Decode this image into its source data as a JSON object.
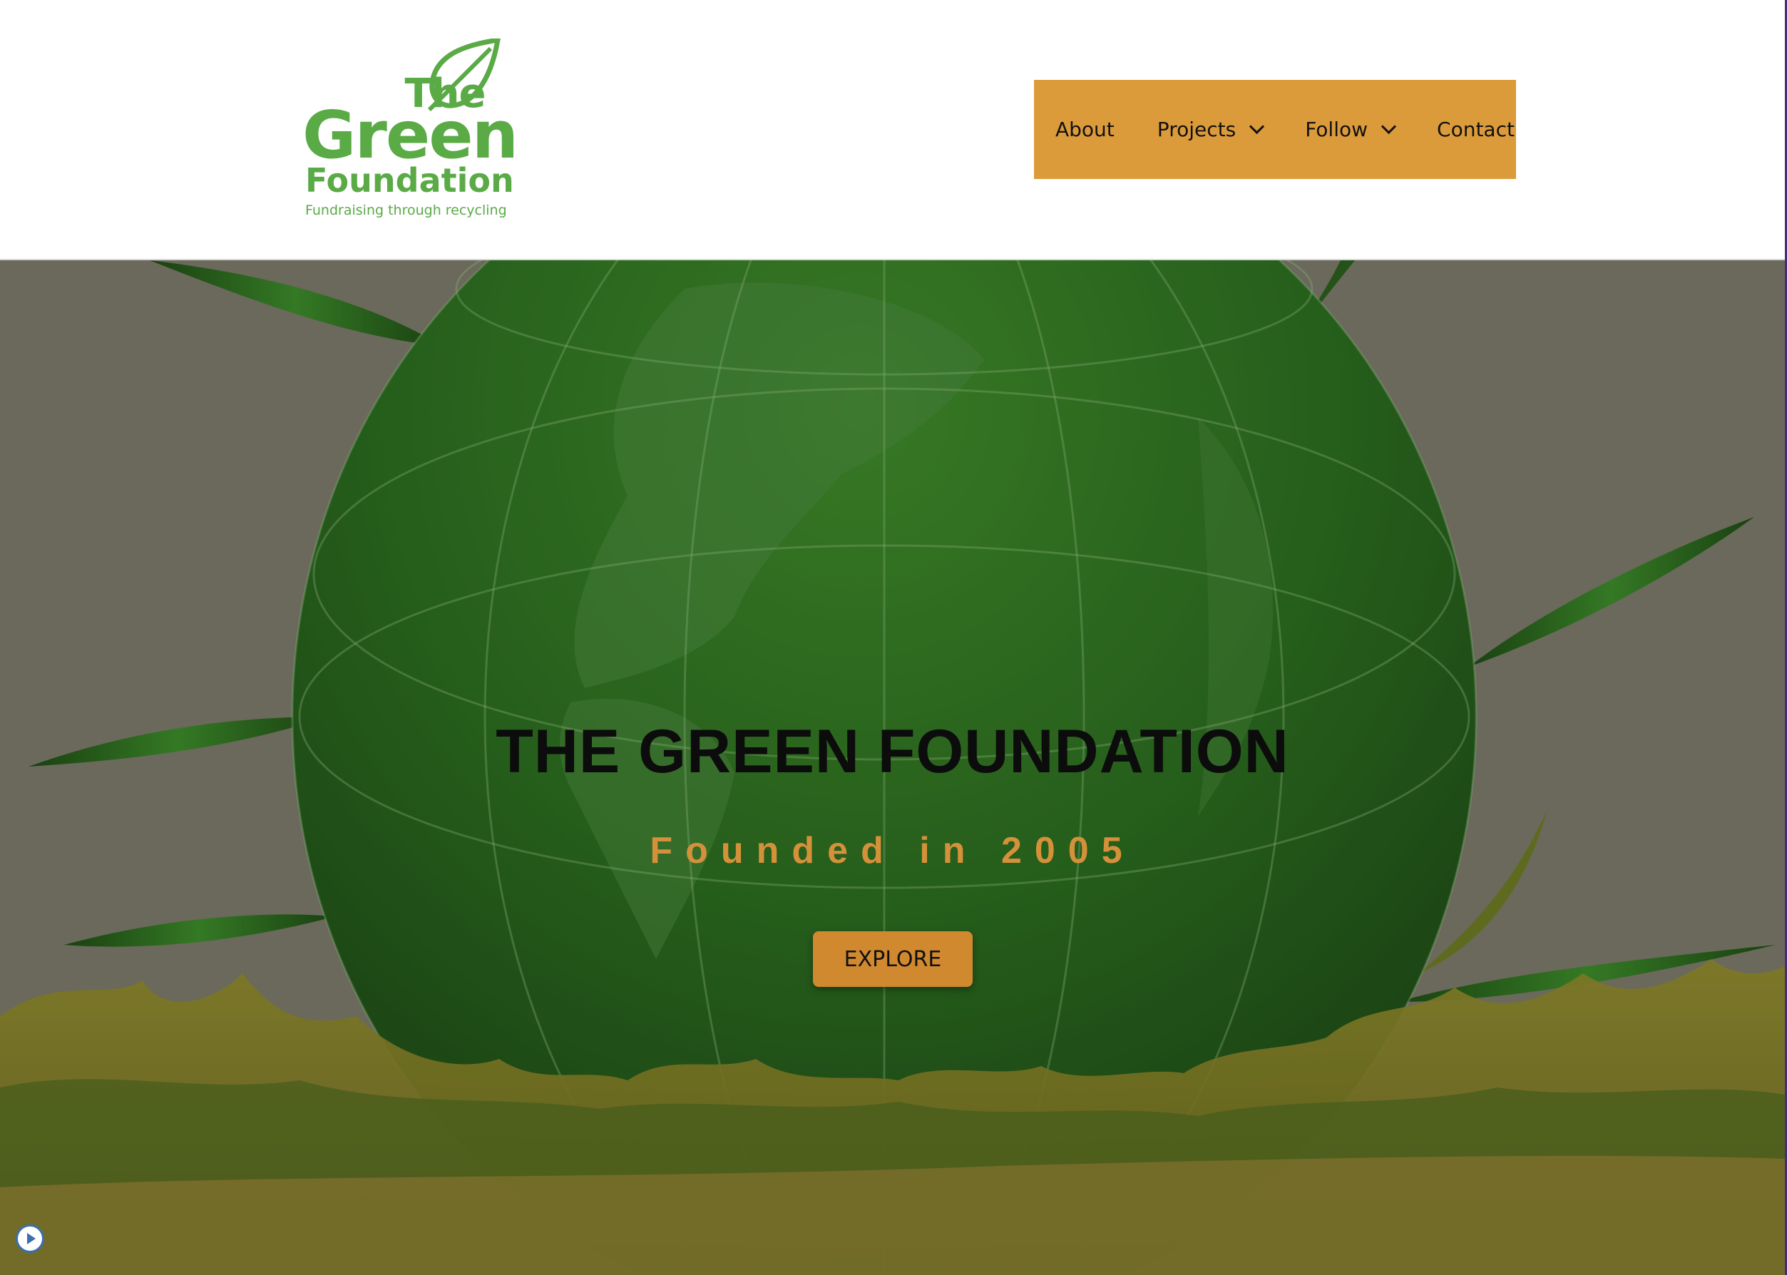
{
  "logo": {
    "line1": "The",
    "line2": "Green",
    "line3": "Foundation",
    "tagline": "Fundraising through recycling"
  },
  "nav": {
    "items": [
      {
        "label": "About",
        "has_dropdown": false
      },
      {
        "label": "Projects",
        "has_dropdown": true
      },
      {
        "label": "Follow",
        "has_dropdown": true
      },
      {
        "label": "Contact",
        "has_dropdown": false
      }
    ]
  },
  "hero": {
    "title": "THE GREEN FOUNDATION",
    "subtitle": "Founded in 2005",
    "button_label": "EXPLORE"
  },
  "colors": {
    "brand_green": "#5aaa46",
    "nav_orange": "#dc9b3b",
    "button_orange": "#d18930",
    "subtitle_orange": "#d4913a"
  },
  "icons": {
    "leaf": "leaf-icon",
    "chevron": "chevron-down-icon",
    "play": "play-icon"
  }
}
